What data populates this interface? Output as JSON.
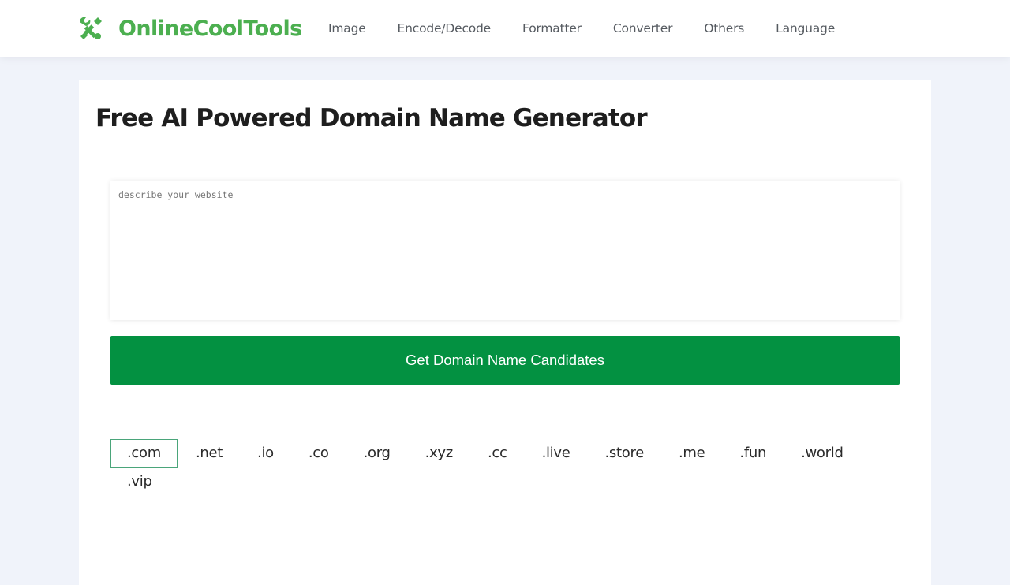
{
  "header": {
    "logo_text": "OnlineCoolTools",
    "logo_icon": "tools-icon",
    "nav": [
      {
        "label": "Image"
      },
      {
        "label": "Encode/Decode"
      },
      {
        "label": "Formatter"
      },
      {
        "label": "Converter"
      },
      {
        "label": "Others"
      },
      {
        "label": "Language"
      }
    ]
  },
  "main": {
    "title": "Free AI Powered Domain Name Generator",
    "description_input": {
      "value": "",
      "placeholder": "describe your website"
    },
    "generate_button_label": "Get Domain Name Candidates",
    "tlds": [
      {
        "label": ".com",
        "selected": true
      },
      {
        "label": ".net",
        "selected": false
      },
      {
        "label": ".io",
        "selected": false
      },
      {
        "label": ".co",
        "selected": false
      },
      {
        "label": ".org",
        "selected": false
      },
      {
        "label": ".xyz",
        "selected": false
      },
      {
        "label": ".cc",
        "selected": false
      },
      {
        "label": ".live",
        "selected": false
      },
      {
        "label": ".store",
        "selected": false
      },
      {
        "label": ".me",
        "selected": false
      },
      {
        "label": ".fun",
        "selected": false
      },
      {
        "label": ".world",
        "selected": false
      },
      {
        "label": ".vip",
        "selected": false
      }
    ]
  },
  "colors": {
    "brand_green": "#4caf50",
    "button_green": "#039141",
    "selected_border": "#4aa57a",
    "page_background": "#f0f3fa"
  }
}
